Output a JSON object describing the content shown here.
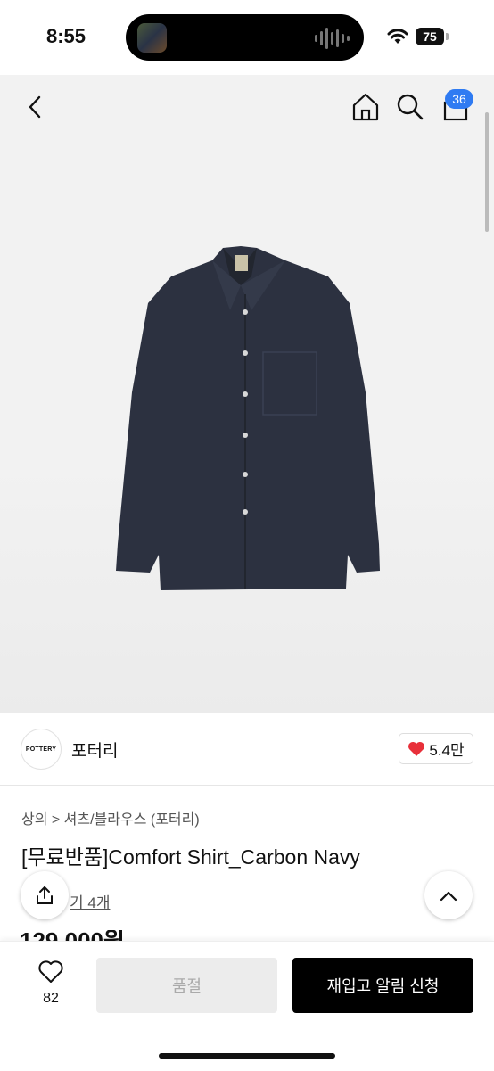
{
  "status": {
    "time": "8:55",
    "battery": "75"
  },
  "nav": {
    "cart_count": "36"
  },
  "brand": {
    "logo_text": "POTTERY",
    "name": "포터리",
    "likes": "5.4만"
  },
  "product": {
    "breadcrumb": "상의 > 셔츠/블라우스 (포터리)",
    "title": "[무료반품]Comfort Shirt_Carbon Navy",
    "reviews": "기 4개",
    "price": "129,000원"
  },
  "bottom": {
    "wish_count": "82",
    "soldout_label": "품절",
    "restock_label": "재입고 알림 신청"
  },
  "colors": {
    "accent_blue": "#2f7bf2",
    "like_red": "#e8303a",
    "shirt": "#2c3140"
  },
  "icons": [
    "back-icon",
    "home-icon",
    "search-icon",
    "cart-icon",
    "heart-icon",
    "share-icon",
    "chevron-up-icon",
    "wifi-icon"
  ]
}
